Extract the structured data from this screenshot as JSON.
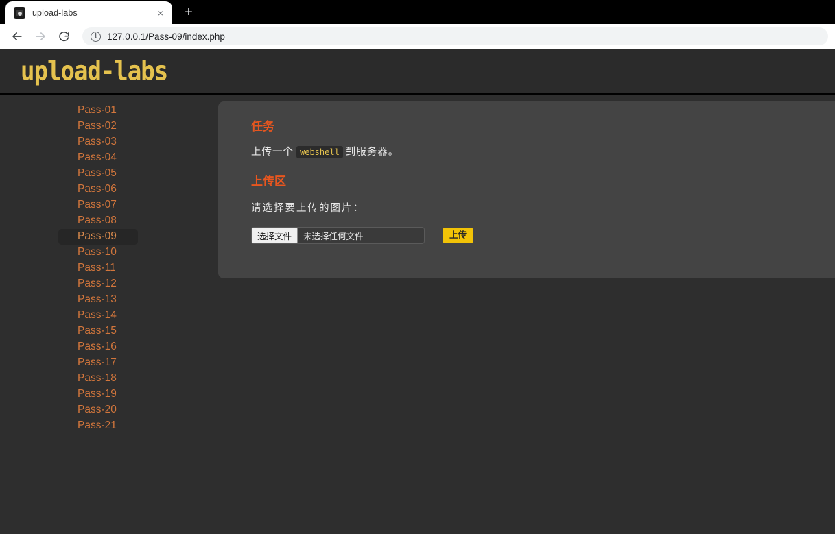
{
  "browser": {
    "tab": {
      "title": "upload-labs",
      "favicon": "camera-favicon",
      "close_label": "×"
    },
    "new_tab_label": "+",
    "back_label": "←",
    "forward_label": "→",
    "reload_label": "↻",
    "site_info_label": "i",
    "url": "127.0.0.1/Pass-09/index.php"
  },
  "site": {
    "logo_text": "upload-labs",
    "logo_color": "#e5c24e",
    "header_bg": "#2b2b2b",
    "page_bg": "#2e2e2e",
    "panel_bg": "#444444",
    "accent_color": "#e8561f",
    "nav_link_color": "#d2763c",
    "button_color": "#f2c307"
  },
  "sidebar": {
    "items": [
      {
        "label": "Pass-01",
        "active": false
      },
      {
        "label": "Pass-02",
        "active": false
      },
      {
        "label": "Pass-03",
        "active": false
      },
      {
        "label": "Pass-04",
        "active": false
      },
      {
        "label": "Pass-05",
        "active": false
      },
      {
        "label": "Pass-06",
        "active": false
      },
      {
        "label": "Pass-07",
        "active": false
      },
      {
        "label": "Pass-08",
        "active": false
      },
      {
        "label": "Pass-09",
        "active": true
      },
      {
        "label": "Pass-10",
        "active": false
      },
      {
        "label": "Pass-11",
        "active": false
      },
      {
        "label": "Pass-12",
        "active": false
      },
      {
        "label": "Pass-13",
        "active": false
      },
      {
        "label": "Pass-14",
        "active": false
      },
      {
        "label": "Pass-15",
        "active": false
      },
      {
        "label": "Pass-16",
        "active": false
      },
      {
        "label": "Pass-17",
        "active": false
      },
      {
        "label": "Pass-18",
        "active": false
      },
      {
        "label": "Pass-19",
        "active": false
      },
      {
        "label": "Pass-20",
        "active": false
      },
      {
        "label": "Pass-21",
        "active": false
      }
    ]
  },
  "main": {
    "task_heading": "任务",
    "task_text_before": "上传一个",
    "task_code": "webshell",
    "task_text_after": "到服务器。",
    "upload_heading": "上传区",
    "upload_label": "请选择要上传的图片：",
    "file_button_label": "选择文件",
    "file_name_text": "未选择任何文件",
    "submit_label": "上传"
  }
}
